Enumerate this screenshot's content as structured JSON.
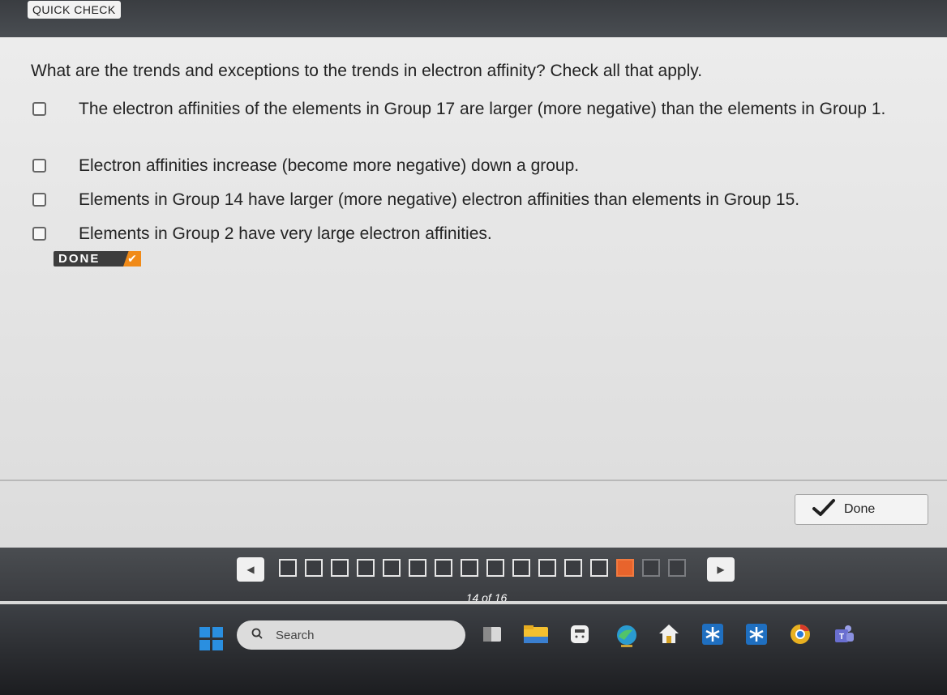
{
  "header": {
    "label": "QUICK CHECK"
  },
  "question": {
    "text": "What are the trends and exceptions to the trends in electron affinity? Check all that apply.",
    "options": [
      {
        "text": "The electron affinities of the elements in Group 17 are larger (more negative) than the elements in Group 1.",
        "checked": false
      },
      {
        "text": "Electron affinities increase (become more negative) down a group.",
        "checked": false
      },
      {
        "text": "Elements in Group 14 have larger (more negative) electron affinities than elements in Group 15.",
        "checked": false
      },
      {
        "text": "Elements in Group 2 have very large electron affinities.",
        "checked": false
      }
    ]
  },
  "status_tag": {
    "label": "DONE",
    "check": "✔"
  },
  "done_button": {
    "label": "Done",
    "icon": "checkmark-icon"
  },
  "navigation": {
    "prev_arrow": "◀",
    "next_arrow": "▶",
    "total_pages": 16,
    "current_page": 14,
    "page_count_text": "14 of 16"
  },
  "taskbar": {
    "search_placeholder": "Search",
    "icons": [
      "start-icon",
      "widgets-icon",
      "file-explorer-icon",
      "calculator-icon",
      "edge-icon",
      "store-icon",
      "app-icon",
      "app-icon-2",
      "chrome-icon",
      "teams-icon"
    ]
  },
  "colors": {
    "accent": "#e8642c",
    "tag_check": "#f08a18",
    "start_blue": "#2a8fe0"
  }
}
